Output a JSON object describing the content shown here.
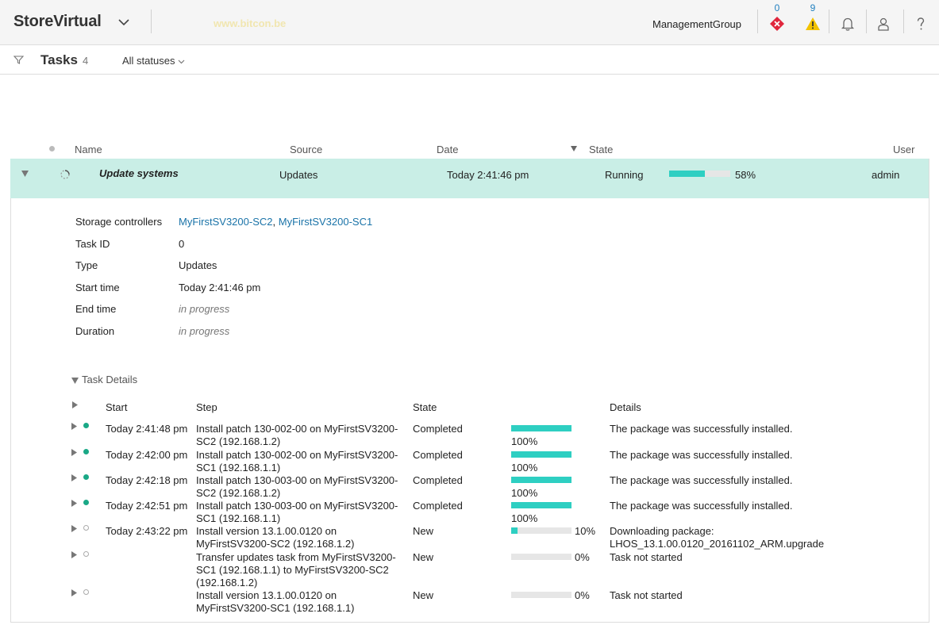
{
  "header": {
    "brand": "StoreVirtual",
    "watermark": "www.bitcon.be",
    "management_group": "ManagementGroup",
    "critical_count": "0",
    "warning_count": "9",
    "colors": {
      "critical": "#e0263c",
      "warning": "#f2c200",
      "count": "#1f7fbf"
    },
    "icons": [
      "chevron-down-icon",
      "critical-alert-icon",
      "warning-icon",
      "bell-icon",
      "user-icon",
      "help-icon"
    ]
  },
  "subheader": {
    "title": "Tasks",
    "count": "4",
    "status_filter": "All statuses"
  },
  "columns": {
    "name": "Name",
    "source": "Source",
    "date": "Date",
    "state": "State",
    "user": "User"
  },
  "task": {
    "name": "Update systems",
    "source": "Updates",
    "date": "Today 2:41:46 pm",
    "state": "Running",
    "progress": 58,
    "progress_label": "58%",
    "user": "admin"
  },
  "details": {
    "storage_controllers_label": "Storage controllers",
    "controller_1": "MyFirstSV3200-SC2",
    "separator": ",",
    "controller_2": "MyFirstSV3200-SC1",
    "task_id_label": "Task ID",
    "task_id": "0",
    "type_label": "Type",
    "type": "Updates",
    "start_time_label": "Start time",
    "start_time": "Today 2:41:46 pm",
    "end_time_label": "End time",
    "end_time": "in progress",
    "duration_label": "Duration",
    "duration": "in progress"
  },
  "task_details": {
    "toggle_label": "Task Details",
    "columns": {
      "start": "Start",
      "step": "Step",
      "state": "State",
      "details": "Details"
    },
    "steps": [
      {
        "start": "Today 2:41:48 pm",
        "step": "Install patch 130-002-00 on MyFirstSV3200-SC2 (192.168.1.2)",
        "state": "Completed",
        "progress": 100,
        "progress_label": "100%",
        "details": "The package was successfully installed.",
        "status": "done"
      },
      {
        "start": "Today 2:42:00 pm",
        "step": "Install patch 130-002-00 on MyFirstSV3200-SC1 (192.168.1.1)",
        "state": "Completed",
        "progress": 100,
        "progress_label": "100%",
        "details": "The package was successfully installed.",
        "status": "done"
      },
      {
        "start": "Today 2:42:18 pm",
        "step": "Install patch 130-003-00 on MyFirstSV3200-SC2 (192.168.1.2)",
        "state": "Completed",
        "progress": 100,
        "progress_label": "100%",
        "details": "The package was successfully installed.",
        "status": "done"
      },
      {
        "start": "Today 2:42:51 pm",
        "step": "Install patch 130-003-00 on MyFirstSV3200-SC1 (192.168.1.1)",
        "state": "Completed",
        "progress": 100,
        "progress_label": "100%",
        "details": "The package was successfully installed.",
        "status": "done"
      },
      {
        "start": "Today 2:43:22 pm",
        "step": "Install version 13.1.00.0120 on MyFirstSV3200-SC2 (192.168.1.2)",
        "state": "New",
        "progress": 10,
        "progress_label": "10%",
        "details": "Downloading package: LHOS_13.1.00.0120_20161102_ARM.upgrade",
        "status": "pending"
      },
      {
        "start": "",
        "step": "Transfer updates task from MyFirstSV3200-SC1 (192.168.1.1) to MyFirstSV3200-SC2 (192.168.1.2)",
        "state": "New",
        "progress": 0,
        "progress_label": "0%",
        "details": "Task not started",
        "status": "pending"
      },
      {
        "start": "",
        "step": "Install version 13.1.00.0120 on MyFirstSV3200-SC1 (192.168.1.1)",
        "state": "New",
        "progress": 0,
        "progress_label": "0%",
        "details": "Task not started",
        "status": "pending"
      }
    ]
  }
}
